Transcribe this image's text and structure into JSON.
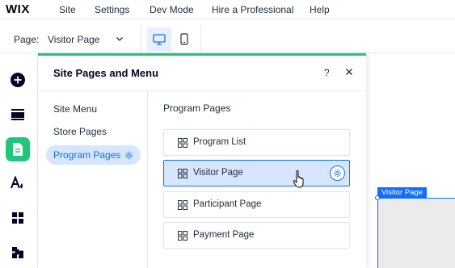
{
  "topbar": {
    "logo": "WIX",
    "menu": [
      {
        "label": "Site"
      },
      {
        "label": "Settings"
      },
      {
        "label": "Dev Mode"
      },
      {
        "label": "Hire a Professional"
      },
      {
        "label": "Help"
      }
    ]
  },
  "toolbar": {
    "page_label": "Page:",
    "page_value": "Visitor Page",
    "caret_icon": "chevron-down-icon",
    "devices": [
      {
        "icon": "desktop-icon",
        "active": true
      },
      {
        "icon": "mobile-icon",
        "active": false
      }
    ]
  },
  "rail": {
    "items": [
      {
        "icon": "add-icon"
      },
      {
        "icon": "sections-icon"
      },
      {
        "icon": "pages-icon",
        "active": true
      },
      {
        "icon": "design-icon"
      },
      {
        "icon": "apps-icon"
      },
      {
        "icon": "business-icon"
      }
    ]
  },
  "panel": {
    "title": "Site Pages and Menu",
    "help": "?",
    "side_items": [
      {
        "label": "Site Menu"
      },
      {
        "label": "Store Pages"
      },
      {
        "label": "Program Pages",
        "active": true
      }
    ],
    "section_title": "Program Pages",
    "pages": [
      {
        "label": "Program List"
      },
      {
        "label": "Visitor Page",
        "selected": true
      },
      {
        "label": "Participant Page"
      },
      {
        "label": "Payment Page"
      }
    ]
  },
  "canvas": {
    "tag": "Visitor Page"
  },
  "colors": {
    "accent": "#116dff",
    "active_panel": "#20c77a",
    "selected_bg": "#d6e6fe"
  }
}
